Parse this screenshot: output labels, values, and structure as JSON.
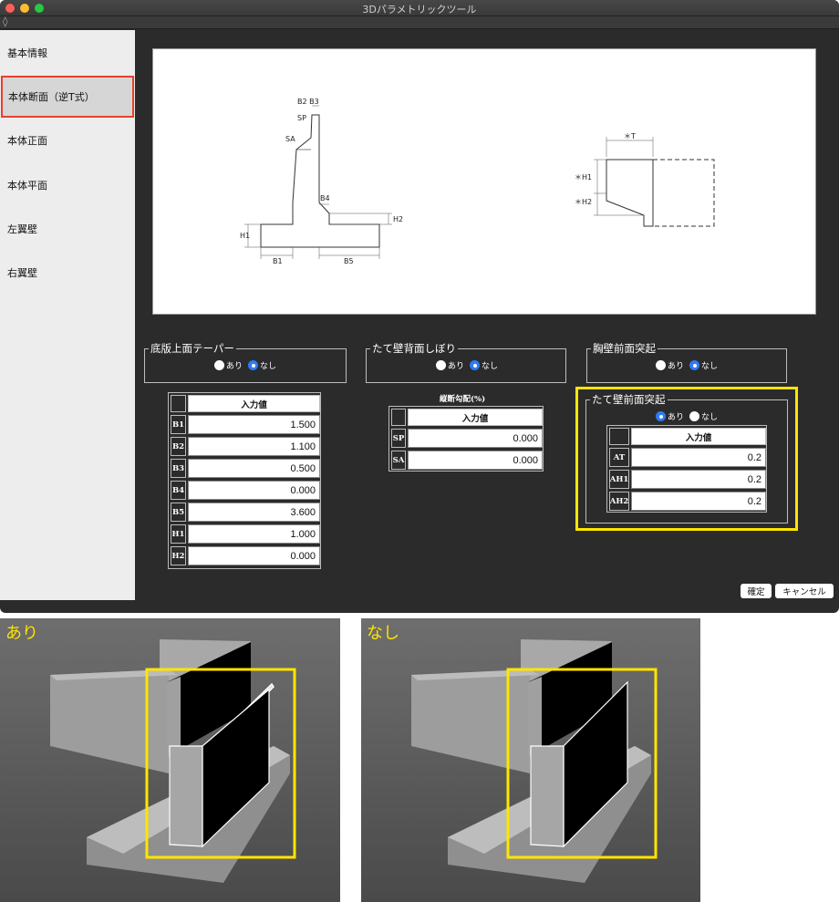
{
  "window": {
    "title": "3Dパラメトリックツール"
  },
  "sidebar": {
    "items": [
      {
        "label": "基本情報"
      },
      {
        "label": "本体断面（逆T式）",
        "selected": true
      },
      {
        "label": "本体正面"
      },
      {
        "label": "本体平面"
      },
      {
        "label": "左翼壁"
      },
      {
        "label": "右翼壁"
      }
    ]
  },
  "diagram": {
    "left_labels": [
      "B2 B3",
      "SP",
      "SA",
      "B4",
      "H2",
      "H1",
      "B1",
      "B5"
    ],
    "right_labels": [
      "＊T",
      "＊H1",
      "＊H2"
    ]
  },
  "groups": {
    "taper": {
      "title": "底版上面テーパー",
      "options": [
        "あり",
        "なし"
      ],
      "selected": "なし"
    },
    "wall_back": {
      "title": "たて壁背面しぼり",
      "options": [
        "あり",
        "なし"
      ],
      "selected": "なし"
    },
    "parapet": {
      "title": "胸壁前面突起",
      "options": [
        "あり",
        "なし"
      ],
      "selected": "なし"
    },
    "wall_front": {
      "title": "たて壁前面突起",
      "options": [
        "あり",
        "なし"
      ],
      "selected": "あり"
    }
  },
  "table_main": {
    "header": "入力値",
    "rows": [
      {
        "key": "B1",
        "value": "1.500"
      },
      {
        "key": "B2",
        "value": "1.100"
      },
      {
        "key": "B3",
        "value": "0.500"
      },
      {
        "key": "B4",
        "value": "0.000"
      },
      {
        "key": "B5",
        "value": "3.600"
      },
      {
        "key": "H1",
        "value": "1.000"
      },
      {
        "key": "H2",
        "value": "0.000"
      }
    ]
  },
  "table_slope": {
    "caption": "縦断勾配(%)",
    "header": "入力値",
    "rows": [
      {
        "key": "SP",
        "value": "0.000"
      },
      {
        "key": "SA",
        "value": "0.000"
      }
    ]
  },
  "table_front": {
    "header": "入力値",
    "rows": [
      {
        "key": "AT",
        "value": "0.2"
      },
      {
        "key": "AH1",
        "value": "0.2"
      },
      {
        "key": "AH2",
        "value": "0.2"
      }
    ]
  },
  "buttons": {
    "ok": "確定",
    "cancel": "キャンセル"
  },
  "previews": {
    "with": "あり",
    "without": "なし"
  },
  "colors": {
    "highlight": "#ffe500",
    "selected_border": "#e8402a",
    "radio_on": "#2f7bf5"
  }
}
